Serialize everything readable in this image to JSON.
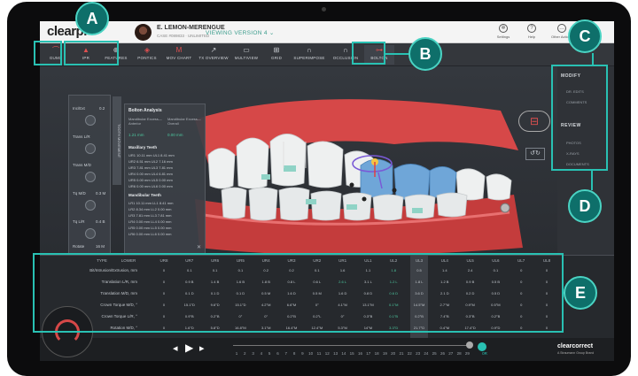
{
  "header": {
    "logo": "clearpl",
    "patient_name": "E. LEMON-MERENGUE",
    "case_info": "CASE #089833 · UNLIMITED",
    "version_label": "VIEWING VERSION 4  ⌄",
    "icons": [
      {
        "icon": "gear-icon",
        "label": "Settings"
      },
      {
        "icon": "help-icon",
        "label": "Help"
      },
      {
        "icon": "more-icon",
        "label": "Other Actions"
      }
    ]
  },
  "toolbar": [
    {
      "icon": "gums-icon",
      "label": "GUMS"
    },
    {
      "icon": "ipr-icon",
      "label": "IPR"
    },
    {
      "icon": "features-icon",
      "label": "FEATURES"
    },
    {
      "icon": "pontics-icon",
      "label": "PONTICS"
    },
    {
      "icon": "mov-chart-icon",
      "label": "MOV CHART"
    },
    {
      "icon": "tx-overview-icon",
      "label": "TX OVERVIEW"
    },
    {
      "icon": "multiview-icon",
      "label": "MULTIVIEW"
    },
    {
      "icon": "grid-icon",
      "label": "GRID"
    },
    {
      "icon": "superimpose-icon",
      "label": "SUPERIMPOSE"
    },
    {
      "icon": "occlusion-icon",
      "label": "OCCLUSION"
    },
    {
      "icon": "bolton-icon",
      "label": "BOLTON"
    }
  ],
  "left_panel": {
    "title": "TOOTH MOVEMENT",
    "controls": [
      "Inc/Ext",
      "Trans L/R",
      "Trans M/D",
      "Tq M/D",
      "Tq L/R",
      "Rotate"
    ],
    "values": [
      "0.2",
      "",
      "",
      "0.3 M",
      "0.4 B",
      "16 M"
    ]
  },
  "bolton": {
    "title": "Bolton Analysis",
    "col1": "Mandibular Excess—Anterior",
    "col2": "Mandibular Excess—Overall",
    "val1": "1.21 mm",
    "val2": "0.00 mm",
    "max_title": "Maxillary Teeth",
    "max_rows": [
      "UR1 10.11 mm  UL1 8.41 mm",
      "UR2 6.51 mm  UL2 7.16 mm",
      "UR3 7.81 mm  UL3 7.81 mm",
      "UR4 0.00 mm  UL4 6.81 mm",
      "UR5 0.00 mm  UL5 0.00 mm",
      "UR6 0.00 mm  UL6 0.00 mm"
    ],
    "man_title": "Mandibular Teeth",
    "man_rows": [
      "LR1 10.11 mm  LL1 8.41 mm",
      "LR2 8.34 mm  LL2 0.00 mm",
      "LR3 7.81 mm  LL3 7.81 mm",
      "LR4 0.00 mm  LL4 0.00 mm",
      "LR5 0.00 mm  LL5 0.00 mm",
      "LR6 0.00 mm  LL6 0.00 mm"
    ]
  },
  "right_nav": {
    "modify": "MODIFY",
    "modify_items": [
      "DR. EDITS",
      "COMMENTS"
    ],
    "review": "REVIEW",
    "review_items": [
      "PHOTOS",
      "X-RAYS",
      "DOCUMENTS"
    ]
  },
  "table": {
    "type_label": "TYPE",
    "lower_label": "LOWER",
    "columns": [
      "UR8",
      "UR7",
      "UR6",
      "UR5",
      "UR4",
      "UR3",
      "UR2",
      "UR1",
      "UL1",
      "UL2",
      "UL3",
      "UL4",
      "UL5",
      "UL6",
      "UL7",
      "UL8"
    ],
    "rows": [
      {
        "label": "Bit/Intrusion/Extrusion, mm",
        "cells": [
          "0",
          "0.1",
          "0.1",
          "0.1",
          "0.2",
          "0.2",
          "0.1",
          "1.6",
          "1.1",
          "1.8",
          "0.5",
          "1.4",
          "2.4",
          "0.1",
          "0",
          "0"
        ]
      },
      {
        "label": "Translation L/R, mm",
        "cells": [
          "0",
          "0.9 B",
          "1.4 B",
          "1.6 B",
          "1.8 B",
          "0.8 L",
          "0.6 L",
          "2.6 L",
          "3.1 L",
          "1.2 L",
          "1.8 L",
          "1.2 B",
          "0.9 B",
          "0.5 B",
          "0",
          "0"
        ]
      },
      {
        "label": "Translation M/D, mm",
        "cells": [
          "0",
          "0.1 D",
          "0.1 D",
          "0.1 D",
          "0.5 M",
          "1.6 D",
          "0.5 M",
          "1.6 D",
          "0.8 D",
          "0.6 D",
          "3.6 D",
          "2.1 D",
          "0.2 D",
          "0.5 D",
          "0",
          "0"
        ]
      },
      {
        "label": "Crown Torque M/D, °",
        "cells": [
          "0",
          "15.1°D",
          "9.6°D",
          "15.1°D",
          "4.2°M",
          "6.6°M",
          "0°",
          "4.1°M",
          "13.1°M",
          "0.1°M",
          "14.5°M",
          "2.7°M",
          "0.9°M",
          "0.5°M",
          "0",
          "0"
        ]
      },
      {
        "label": "Crown Torque L/R, °",
        "cells": [
          "0",
          "0.9°B",
          "0.2°B",
          "0°",
          "0°",
          "0.2°B",
          "0.2°L",
          "0°",
          "0.3°B",
          "0.1°B",
          "0.2°B",
          "7.4°B",
          "0.3°B",
          "0.2°B",
          "0",
          "0"
        ]
      },
      {
        "label": "Rotation M/D, °",
        "cells": [
          "0",
          "1.6°D",
          "5.8°D",
          "16.8°M",
          "3.1°M",
          "16.4°M",
          "12.4°M",
          "5.3°M",
          "14°M",
          "3.3°D",
          "21.7°D",
          "0.4°M",
          "17.4°D",
          "0.9°D",
          "0",
          "0"
        ]
      }
    ]
  },
  "timeline": {
    "stages": [
      "1",
      "2",
      "3",
      "4",
      "5",
      "6",
      "7",
      "8",
      "9",
      "10",
      "11",
      "12",
      "13",
      "14",
      "15",
      "16",
      "17",
      "18",
      "19",
      "20",
      "21",
      "22",
      "23",
      "24",
      "25",
      "26",
      "27",
      "28",
      "29"
    ],
    "active_stage": 29,
    "end_label": "0R",
    "brand": "clearcorrect",
    "brand_sub": "A Straumann Group Brand"
  },
  "callouts": [
    "A",
    "B",
    "C",
    "D",
    "E"
  ],
  "colors": {
    "accent": "#29c1b3",
    "callout_fill": "#0e6f6a",
    "gum": "#d64848",
    "tooth": "#eef0f0",
    "moved_tooth": "#6fa6d8"
  }
}
